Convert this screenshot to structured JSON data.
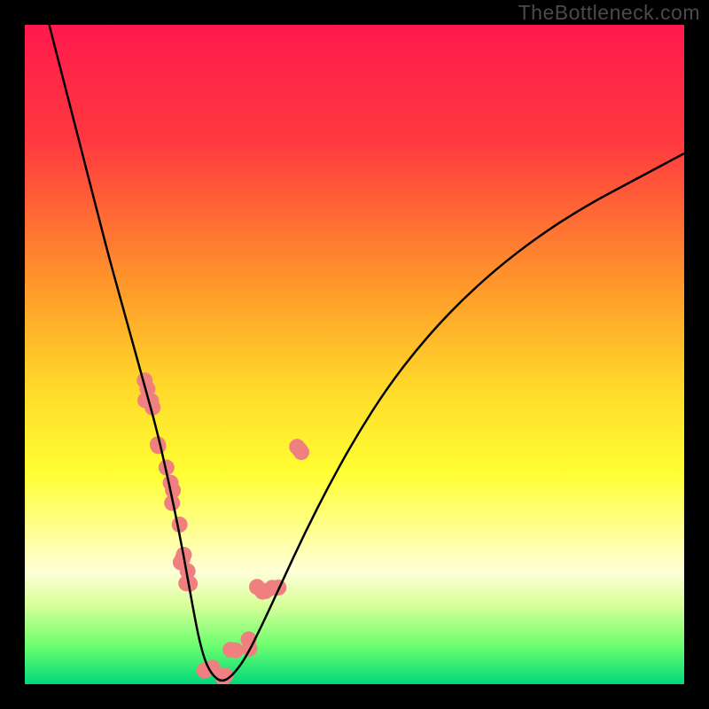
{
  "watermark": "TheBottleneck.com",
  "chart_data": {
    "type": "line",
    "title": "",
    "xlabel": "",
    "ylabel": "",
    "xlim": [
      0,
      100
    ],
    "ylim": [
      0,
      100
    ],
    "gradient_stops": [
      {
        "offset": 0,
        "color": "#ff1a4d"
      },
      {
        "offset": 18,
        "color": "#ff3a3f"
      },
      {
        "offset": 40,
        "color": "#ff9a2a"
      },
      {
        "offset": 55,
        "color": "#ffd92a"
      },
      {
        "offset": 68,
        "color": "#ffff33"
      },
      {
        "offset": 78,
        "color": "#ffffa0"
      },
      {
        "offset": 83,
        "color": "#ffffd8"
      },
      {
        "offset": 88,
        "color": "#d8ff9a"
      },
      {
        "offset": 94,
        "color": "#6fff6f"
      },
      {
        "offset": 100,
        "color": "#00d87a"
      }
    ],
    "series": [
      {
        "name": "bottleneck-curve",
        "x": [
          3.7,
          5.5,
          7.3,
          9.1,
          10.9,
          12.7,
          14.5,
          16.3,
          18.1,
          19.9,
          21.3,
          22.6,
          23.8,
          24.8,
          25.7,
          26.5,
          27.4,
          28.5,
          29.9,
          31.5,
          33.5,
          36,
          39,
          42.5,
          46.3,
          50.5,
          55,
          60,
          65.5,
          71.5,
          78,
          85,
          92.5,
          100
        ],
        "values": [
          100,
          93,
          86,
          79,
          72,
          65,
          58.5,
          52,
          45.5,
          39,
          33,
          27,
          21,
          15.5,
          10.5,
          6.5,
          3.3,
          1.3,
          0.3,
          1.3,
          4,
          9,
          15.5,
          23,
          30.5,
          38,
          45,
          51.5,
          57.5,
          63,
          68,
          72.5,
          76.5,
          80.5
        ]
      }
    ],
    "dot_clusters": [
      {
        "x_range": [
          16.5,
          19.5
        ],
        "y_range": [
          37,
          49
        ],
        "count": 5
      },
      {
        "x_range": [
          19.5,
          23.5
        ],
        "y_range": [
          20,
          37
        ],
        "count": 7
      },
      {
        "x_range": [
          23.5,
          27
        ],
        "y_range": [
          5,
          20
        ],
        "count": 6
      },
      {
        "x_range": [
          27,
          30.5
        ],
        "y_range": [
          0,
          5
        ],
        "count": 5
      },
      {
        "x_range": [
          30.5,
          35
        ],
        "y_range": [
          4,
          14
        ],
        "count": 4
      },
      {
        "x_range": [
          35,
          40.5
        ],
        "y_range": [
          14,
          35
        ],
        "count": 5
      },
      {
        "x_range": [
          40.5,
          43
        ],
        "y_range": [
          35,
          44
        ],
        "count": 3
      }
    ],
    "dot_color": "#f08080",
    "dot_radius_px": 9
  }
}
